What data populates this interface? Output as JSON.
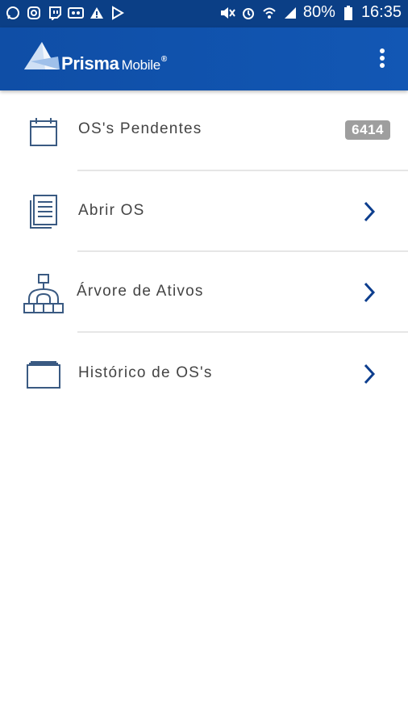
{
  "status_bar": {
    "battery": "80%",
    "time": "16:35",
    "left_icons": [
      "whatsapp-icon",
      "instagram-icon",
      "twitch-icon",
      "voicemail-icon",
      "alert-icon",
      "play-store-icon"
    ],
    "right_icons": [
      "mute-icon",
      "alarm-icon",
      "wifi-icon",
      "signal-icon",
      "battery-icon"
    ]
  },
  "app_bar": {
    "brand": "Prisma",
    "brand_sub": "Mobile",
    "reg_mark": "®",
    "accent": "#1256b0"
  },
  "menu": {
    "items": [
      {
        "label": "OS's Pendentes",
        "icon": "calendar-icon",
        "badge": "6414"
      },
      {
        "label": "Abrir OS",
        "icon": "document-icon"
      },
      {
        "label": "Árvore de Ativos",
        "icon": "asset-tree-icon"
      },
      {
        "label": "Histórico de OS's",
        "icon": "folder-icon"
      }
    ]
  }
}
